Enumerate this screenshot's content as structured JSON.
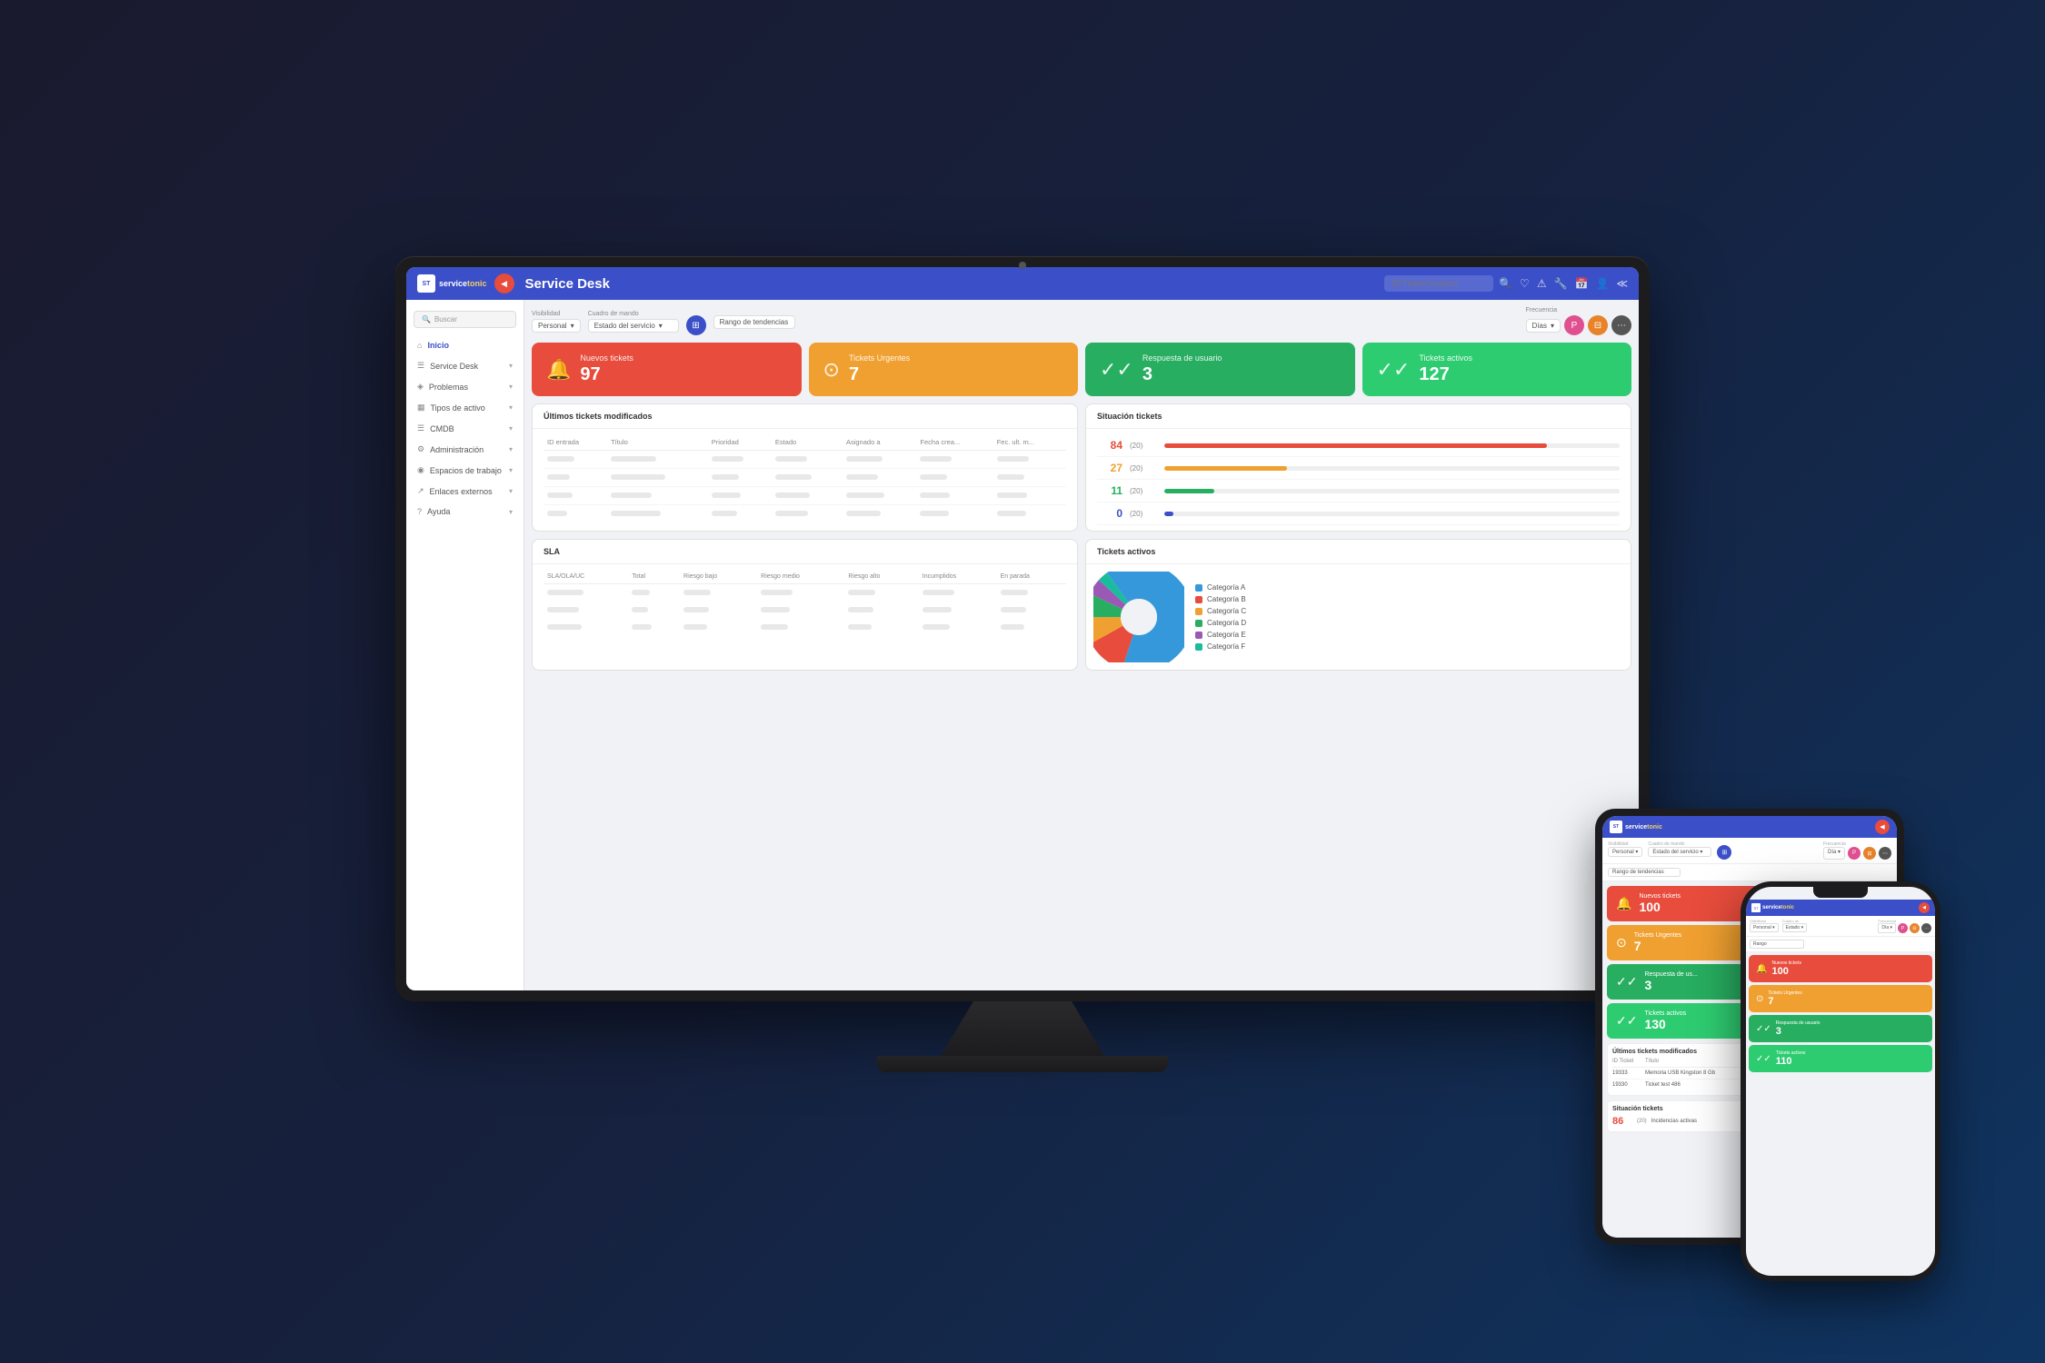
{
  "app": {
    "title": "Service Desk",
    "logo_service": "service",
    "logo_tonic": "tonic",
    "nav_toggle_icon": "◀"
  },
  "header": {
    "search_placeholder": "ID/Título/Contacto",
    "icons": [
      "🔍",
      "♡",
      "⚠",
      "🔧",
      "📅",
      "👤",
      "≪"
    ]
  },
  "sidebar": {
    "search_placeholder": "Buscar",
    "items": [
      {
        "label": "Inicio",
        "icon": "⌂",
        "active": true,
        "has_chevron": false
      },
      {
        "label": "Service Desk",
        "icon": "☰",
        "active": false,
        "has_chevron": true
      },
      {
        "label": "Problemas",
        "icon": "◈",
        "active": false,
        "has_chevron": true
      },
      {
        "label": "Tipos de activo",
        "icon": "▦",
        "active": false,
        "has_chevron": true
      },
      {
        "label": "CMDB",
        "icon": "☰",
        "active": false,
        "has_chevron": true
      },
      {
        "label": "Administración",
        "icon": "⚙",
        "active": false,
        "has_chevron": true
      },
      {
        "label": "Espacios de trabajo",
        "icon": "◉",
        "active": false,
        "has_chevron": true
      },
      {
        "label": "Enlaces externos",
        "icon": "↗",
        "active": false,
        "has_chevron": true
      },
      {
        "label": "Ayuda",
        "icon": "?",
        "active": false,
        "has_chevron": true
      }
    ]
  },
  "toolbar": {
    "visibility_label": "Visibilidad",
    "visibility_value": "Personal",
    "dashboard_label": "Cuadro de mando",
    "dashboard_value": "Estado del servicio",
    "trends_label": "Rango de tendencias",
    "trends_placeholder": "Rango de tendencias",
    "frequency_label": "Frecuencia",
    "frequency_value": "Días",
    "btn_grid": "⊞",
    "btn_filter": "⊟",
    "btn_more": "⋯"
  },
  "stats": [
    {
      "label": "Nuevos tickets",
      "value": "97",
      "icon": "🔔",
      "color": "red"
    },
    {
      "label": "Tickets Urgentes",
      "value": "7",
      "icon": "⊙",
      "color": "orange"
    },
    {
      "label": "Respuesta de usuario",
      "value": "3",
      "icon": "✓✓",
      "color": "green"
    },
    {
      "label": "Tickets activos",
      "value": "127",
      "icon": "✓✓",
      "color": "green2"
    }
  ],
  "last_tickets": {
    "title": "Últimos tickets modificados",
    "columns": [
      "ID entrada",
      "Título",
      "Prioridad",
      "Estado",
      "Asignado a",
      "Fecha crea...",
      "Fec. ult. m..."
    ],
    "rows": [
      [
        "—",
        "—",
        "—",
        "—",
        "—",
        "—",
        "—"
      ],
      [
        "—",
        "—",
        "—",
        "—",
        "—",
        "—",
        "—"
      ],
      [
        "—",
        "—",
        "—",
        "—",
        "—",
        "—",
        "—"
      ],
      [
        "—",
        "—",
        "—",
        "—",
        "—",
        "—",
        "—"
      ]
    ]
  },
  "situacion": {
    "title": "Situación tickets",
    "items": [
      {
        "num": "84",
        "count": "(20)",
        "pct": 84,
        "color": "#e74c3c"
      },
      {
        "num": "27",
        "count": "(20)",
        "pct": 27,
        "color": "#f0a030"
      },
      {
        "num": "11",
        "count": "(20)",
        "pct": 11,
        "color": "#27ae60"
      },
      {
        "num": "0",
        "count": "(20)",
        "pct": 0,
        "color": "#3b4fc8"
      }
    ]
  },
  "sla": {
    "title": "SLA",
    "columns": [
      "SLA/OLA/UC",
      "Total",
      "Riesgo bajo",
      "Riesgo medio",
      "Riesgo alto",
      "Incumplidos",
      "En parada"
    ],
    "rows": [
      [
        "—",
        "—",
        "—",
        "—",
        "—",
        "—",
        "—"
      ],
      [
        "—",
        "—",
        "—",
        "—",
        "—",
        "—",
        "—"
      ],
      [
        "—",
        "—",
        "—",
        "—",
        "—",
        "—",
        "—"
      ]
    ]
  },
  "active_tickets": {
    "title": "Tickets activos",
    "legend": [
      {
        "label": "Categoría A",
        "color": "#3498db",
        "pct": 65
      },
      {
        "label": "Categoría B",
        "color": "#e74c3c",
        "pct": 12
      },
      {
        "label": "Categoría C",
        "color": "#f0a030",
        "pct": 8
      },
      {
        "label": "Categoría D",
        "color": "#27ae60",
        "pct": 7
      },
      {
        "label": "Categoría E",
        "color": "#9b59b6",
        "pct": 5
      },
      {
        "label": "Categoría F",
        "color": "#1abc9c",
        "pct": 3
      }
    ]
  },
  "tablet": {
    "stats": [
      {
        "label": "Nuevos tickets",
        "value": "100",
        "icon": "🔔",
        "color": "red"
      },
      {
        "label": "Tickets Urgentes",
        "value": "7",
        "icon": "⊙",
        "color": "orange"
      },
      {
        "label": "Respuesta de us...",
        "value": "3",
        "icon": "✓✓",
        "color": "green"
      },
      {
        "label": "Tickets activos",
        "value": "130",
        "icon": "✓✓",
        "color": "green2"
      }
    ],
    "last_tickets_title": "Últimos tickets modificados",
    "situacion_title": "Situación tickets",
    "situacion_num": "86"
  },
  "phone": {
    "stats": [
      {
        "label": "Nuevos tickets",
        "value": "100",
        "icon": "🔔",
        "color": "red"
      },
      {
        "label": "Tickets Urgentes",
        "value": "7",
        "icon": "⊙",
        "color": "orange"
      },
      {
        "label": "Respuesta de usuario",
        "value": "3",
        "icon": "✓✓",
        "color": "green"
      },
      {
        "label": "Tickets activos",
        "value": "110",
        "icon": "✓✓",
        "color": "green2"
      }
    ]
  }
}
